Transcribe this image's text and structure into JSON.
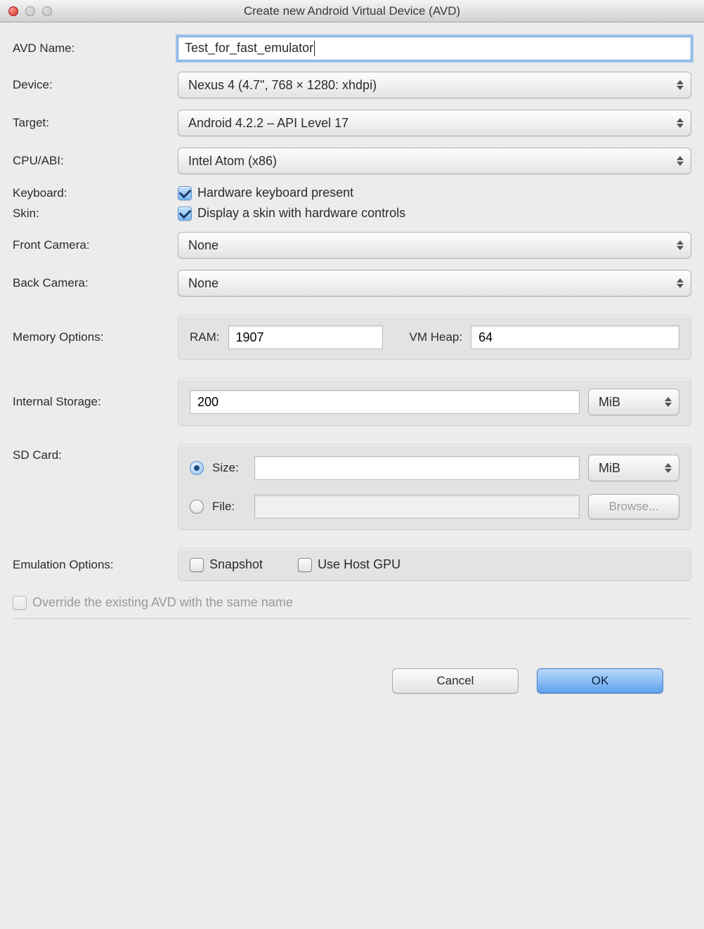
{
  "window": {
    "title": "Create new Android Virtual Device (AVD)"
  },
  "labels": {
    "avd_name": "AVD Name:",
    "device": "Device:",
    "target": "Target:",
    "cpu": "CPU/ABI:",
    "keyboard": "Keyboard:",
    "skin": "Skin:",
    "front_camera": "Front Camera:",
    "back_camera": "Back Camera:",
    "memory": "Memory Options:",
    "internal_storage": "Internal Storage:",
    "sd_card": "SD Card:",
    "emulation": "Emulation Options:"
  },
  "fields": {
    "avd_name": "Test_for_fast_emulator",
    "device": "Nexus 4 (4.7\", 768 × 1280: xhdpi)",
    "target": "Android 4.2.2 – API Level 17",
    "cpu": "Intel Atom (x86)",
    "keyboard_label": "Hardware keyboard present",
    "skin_label": "Display a skin with hardware controls",
    "front_camera": "None",
    "back_camera": "None",
    "ram_label": "RAM:",
    "ram_value": "1907",
    "vmheap_label": "VM Heap:",
    "vmheap_value": "64",
    "internal_storage_value": "200",
    "internal_storage_unit": "MiB",
    "sd_size_label": "Size:",
    "sd_size_value": "",
    "sd_size_unit": "MiB",
    "sd_file_label": "File:",
    "sd_file_value": "",
    "browse_label": "Browse...",
    "snapshot_label": "Snapshot",
    "host_gpu_label": "Use Host GPU",
    "override_label": "Override the existing AVD with the same name"
  },
  "buttons": {
    "cancel": "Cancel",
    "ok": "OK"
  },
  "state": {
    "keyboard_checked": true,
    "skin_checked": true,
    "sd_mode": "size",
    "snapshot_checked": false,
    "host_gpu_checked": false,
    "override_checked": false,
    "override_disabled": true
  }
}
